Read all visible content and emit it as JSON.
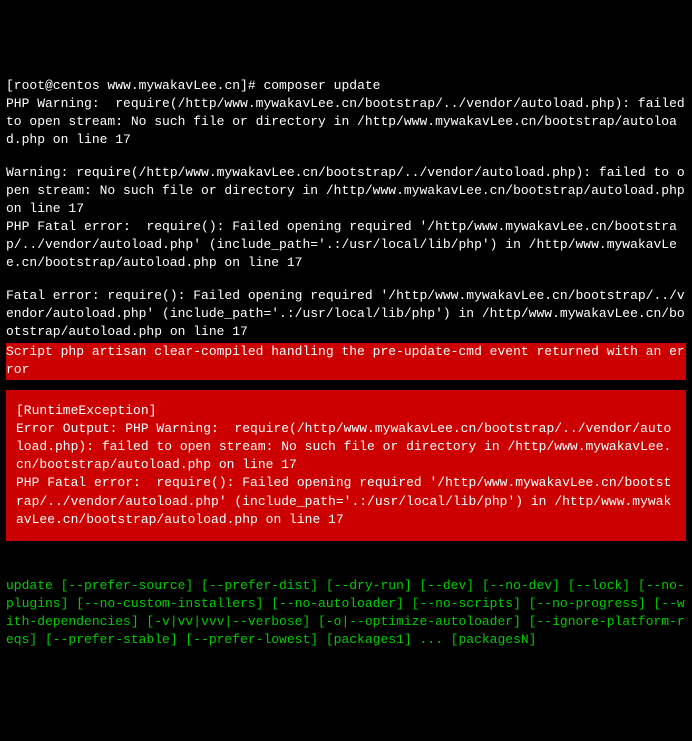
{
  "prompt": {
    "user_host": "[root@centos ",
    "cwd": "www.mywakavLee.cn",
    "end": "]# ",
    "command": "composer update"
  },
  "out": {
    "l1": "PHP Warning:  require(/http/www.mywakavLee.cn/bootstrap/../vendor/autoload.php): failed to open stream: No such file or directory in /http/www.mywakavLee.cn/bootstrap/autoload.php on line 17",
    "l2": "Warning: require(/http/www.mywakavLee.cn/bootstrap/../vendor/autoload.php): failed to open stream: No such file or directory in /http/www.mywakavLee.cn/bootstrap/autoload.php on line 17",
    "l3": "PHP Fatal error:  require(): Failed opening required '/http/www.mywakavLee.cn/bootstrap/../vendor/autoload.php' (include_path='.:/usr/local/lib/php') in /http/www.mywakavLee.cn/bootstrap/autoload.php on line 17",
    "l4": "Fatal error: require(): Failed opening required '/http/www.mywakavLee.cn/bootstrap/../vendor/autoload.php' (include_path='.:/usr/local/lib/php') in /http/www.mywakavLee.cn/bootstrap/autoload.php on line 17"
  },
  "script_error": "Script php artisan clear-compiled handling the pre-update-cmd event returned with an error",
  "runtime_box": {
    "title": "[RuntimeException]",
    "body": "Error Output: PHP Warning:  require(/http/www.mywakavLee.cn/bootstrap/../vendor/autoload.php): failed to open stream: No such file or directory in /http/www.mywakavLee.cn/bootstrap/autoload.php on line 17\nPHP Fatal error:  require(): Failed opening required '/http/www.mywakavLee.cn/bootstrap/../vendor/autoload.php' (include_path='.:/usr/local/lib/php') in /http/www.mywakavLee.cn/bootstrap/autoload.php on line 17"
  },
  "usage": "update [--prefer-source] [--prefer-dist] [--dry-run] [--dev] [--no-dev] [--lock] [--no-plugins] [--no-custom-installers] [--no-autoloader] [--no-scripts] [--no-progress] [--with-dependencies] [-v|vv|vvv|--verbose] [-o|--optimize-autoloader] [--ignore-platform-reqs] [--prefer-stable] [--prefer-lowest] [packages1] ... [packagesN]"
}
